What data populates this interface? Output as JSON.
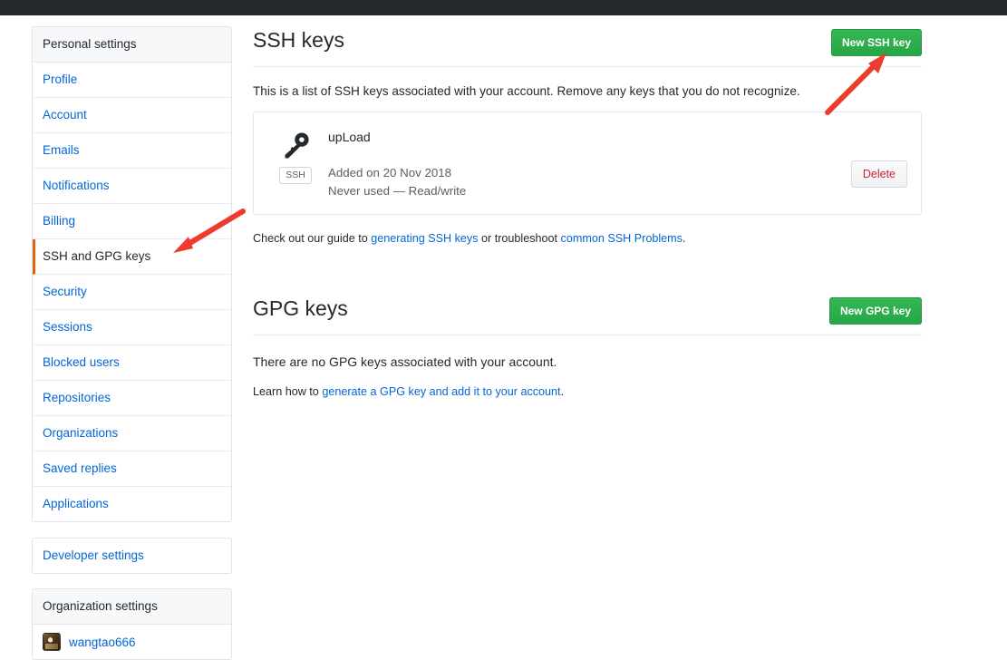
{
  "sidebar": {
    "personal_header": "Personal settings",
    "items": [
      {
        "label": "Profile",
        "active": false
      },
      {
        "label": "Account",
        "active": false
      },
      {
        "label": "Emails",
        "active": false
      },
      {
        "label": "Notifications",
        "active": false
      },
      {
        "label": "Billing",
        "active": false
      },
      {
        "label": "SSH and GPG keys",
        "active": true
      },
      {
        "label": "Security",
        "active": false
      },
      {
        "label": "Sessions",
        "active": false
      },
      {
        "label": "Blocked users",
        "active": false
      },
      {
        "label": "Repositories",
        "active": false
      },
      {
        "label": "Organizations",
        "active": false
      },
      {
        "label": "Saved replies",
        "active": false
      },
      {
        "label": "Applications",
        "active": false
      }
    ],
    "developer_settings": "Developer settings",
    "organization_header": "Organization settings",
    "organizations": [
      {
        "name": "wangtao666",
        "avatar_icon": "user-avatar-image"
      }
    ]
  },
  "ssh_section": {
    "title": "SSH keys",
    "new_button": "New SSH key",
    "description": "This is a list of SSH keys associated with your account. Remove any keys that you do not recognize.",
    "keys": [
      {
        "name": "upLoad",
        "icon": "key-icon",
        "badge": "SSH",
        "added": "Added on 20 Nov 2018",
        "usage": "Never used — Read/write",
        "delete_label": "Delete"
      }
    ],
    "helper_prefix": "Check out our guide to ",
    "helper_link1": "generating SSH keys",
    "helper_middle": " or troubleshoot ",
    "helper_link2": "common SSH Problems",
    "helper_suffix": "."
  },
  "gpg_section": {
    "title": "GPG keys",
    "new_button": "New GPG key",
    "description": "There are no GPG keys associated with your account.",
    "learn_prefix": "Learn how to ",
    "learn_link": "generate a GPG key and add it to your account",
    "learn_suffix": "."
  },
  "annotations": [
    {
      "name": "arrow-to-new-ssh-key-button",
      "color": "#ef3b2d"
    },
    {
      "name": "arrow-to-ssh-and-gpg-keys-nav",
      "color": "#ef3b2d"
    }
  ],
  "colors": {
    "accent_green": "#2ea44f",
    "link_blue": "#0366d6",
    "active_border_orange": "#e36209",
    "danger_red": "#cb2431",
    "topbar_dark": "#24292e",
    "annotation_red": "#ef3b2d"
  }
}
